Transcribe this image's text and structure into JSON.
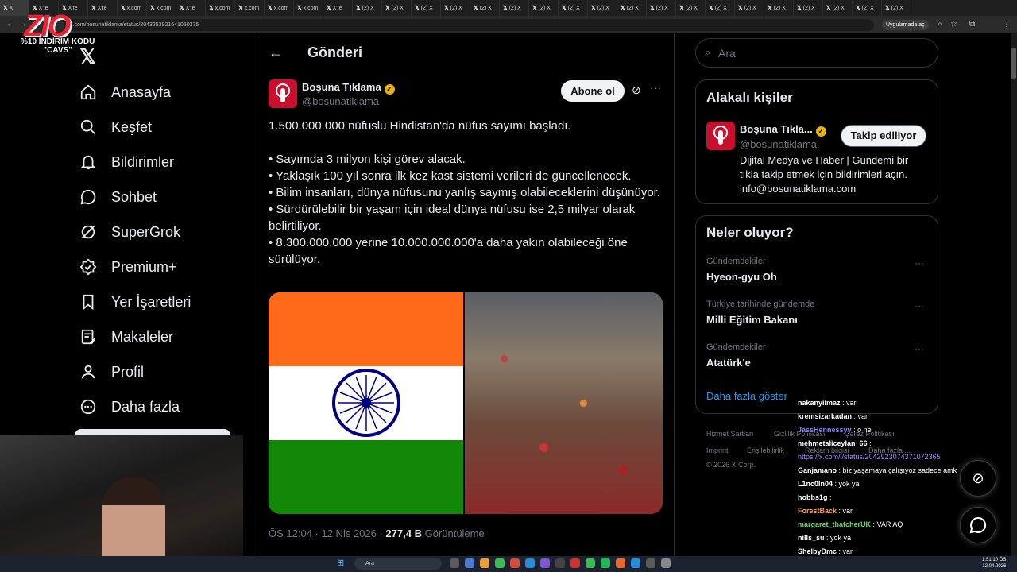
{
  "browser": {
    "tabs": [
      "X",
      "X'te",
      "X'te",
      "X'te",
      "x.com",
      "x.com",
      "X'te",
      "x.com",
      "x.com",
      "x.com",
      "x.com",
      "X'te",
      "(2) X",
      "(2) X",
      "(2) X",
      "(2) X",
      "(2) X",
      "(2) X",
      "(2) X",
      "(2) X",
      "(2) X",
      "(2) X",
      "(2) X",
      "(2) X",
      "(2) X",
      "(2) X",
      "(2) X",
      "(2) X",
      "(2) X",
      "(2) X",
      "(2) X"
    ],
    "url": "x.com/bosunatiklama/status/2043253921641050375",
    "app_badge": "Uygulamada aç"
  },
  "overlay": {
    "logo": "ZIO",
    "promo_line1": "%10 İNDİRİM KODU",
    "promo_line2": "\"CAVS\""
  },
  "sidebar": {
    "items": [
      {
        "label": "Anasayfa",
        "icon": "home-icon"
      },
      {
        "label": "Keşfet",
        "icon": "search-icon"
      },
      {
        "label": "Bildirimler",
        "icon": "bell-icon"
      },
      {
        "label": "Sohbet",
        "icon": "chat-icon"
      },
      {
        "label": "SuperGrok",
        "icon": "grok-icon"
      },
      {
        "label": "Premium+",
        "icon": "premium-icon"
      },
      {
        "label": "Yer İşaretleri",
        "icon": "bookmark-icon"
      },
      {
        "label": "Makaleler",
        "icon": "article-icon"
      },
      {
        "label": "Profil",
        "icon": "profile-icon"
      },
      {
        "label": "Daha fazla",
        "icon": "more-icon"
      }
    ]
  },
  "main": {
    "title": "Gönderi",
    "author_name": "Boşuna Tıklama",
    "author_handle": "@bosunatiklama",
    "subscribe_label": "Abone ol",
    "tweet_lines": [
      "1.500.000.000 nüfuslu Hindistan'da nüfus sayımı başladı.",
      "",
      "• Sayımda 3 milyon kişi görev alacak.",
      "• Yaklaşık 100 yıl sonra ilk kez kast sistemi verileri de güncellenecek.",
      "• Bilim insanları, dünya nüfusunu yanlış saymış olabileceklerini düşünüyor.",
      "• Sürdürülebilir bir yaşam için ideal dünya nüfusu ise 2,5 milyar olarak belirtiliyor.",
      "• 8.300.000.000 yerine 10.000.000.000'a daha yakın olabileceği öne sürülüyor."
    ],
    "time": "ÖS 12:04 · 12 Nis 2026 · ",
    "views": "277,4 B",
    "views_label": " Görüntüleme"
  },
  "right": {
    "search_placeholder": "Ara",
    "related_title": "Alakalı kişiler",
    "related_name": "Boşuna Tıkla...",
    "related_handle": "@bosunatiklama",
    "follow_label": "Takip ediliyor",
    "related_bio": "Dijital Medya ve Haber | Gündemi bir tıkla takip etmek için bildirimleri açın. info@bosunatiklama.com",
    "trends_title": "Neler oluyor?",
    "trends": [
      {
        "category": "Gündemdekiler",
        "name": "Hyeon-gyu Oh"
      },
      {
        "category": "Türkiye tarihinde gündemde",
        "name": "Milli Eğitim Bakanı"
      },
      {
        "category": "Gündemdekiler",
        "name": "Atatürk'e"
      }
    ],
    "show_more": "Daha fazla göster",
    "footer": [
      "Hizmet Şartları",
      "Gizlilik Politikası",
      "Çerez Politikası",
      "Imprint",
      "Erişilebilirlik",
      "Reklam bilgisi",
      "Daha fazla ...",
      "© 2026 X Corp."
    ]
  },
  "chat": [
    {
      "user": "nakanyiimaz",
      "msg": " : var",
      "color": "#ffffff"
    },
    {
      "user": "kremsizarkadan",
      "msg": " : var",
      "color": "#ffffff"
    },
    {
      "user": "JassHennessyy",
      "msg": " : o ne",
      "color": "#8a7cff"
    },
    {
      "user": "mehmetaliceylan_66",
      "msg": " :",
      "color": "#ffffff"
    },
    {
      "user": "",
      "msg": "https://x.com/i/status/2042923074371072365",
      "color": "#a78bfa"
    },
    {
      "user": "Ganjamano",
      "msg": " : biz yaşamaya çalışıyoz sadece amk",
      "color": "#ffffff"
    },
    {
      "user": "L1nc0ln04",
      "msg": " : yok ya",
      "color": "#ffffff"
    },
    {
      "user": "hobbs1g",
      "msg": " : ",
      "color": "#ffffff"
    },
    {
      "user": "ForestBack",
      "msg": " : var",
      "color": "#ff9d4d"
    },
    {
      "user": "margaret_thatcherUK",
      "msg": " : VAR AQ",
      "color": "#6fd36f"
    },
    {
      "user": "nills_su",
      "msg": " : yok ya",
      "color": "#ffffff"
    },
    {
      "user": "ShelbyDmc",
      "msg": " : var",
      "color": "#ffffff"
    }
  ],
  "taskbar": {
    "search": "Ara",
    "time": "1:51:10 ÖS",
    "date": "12.04.2026"
  }
}
